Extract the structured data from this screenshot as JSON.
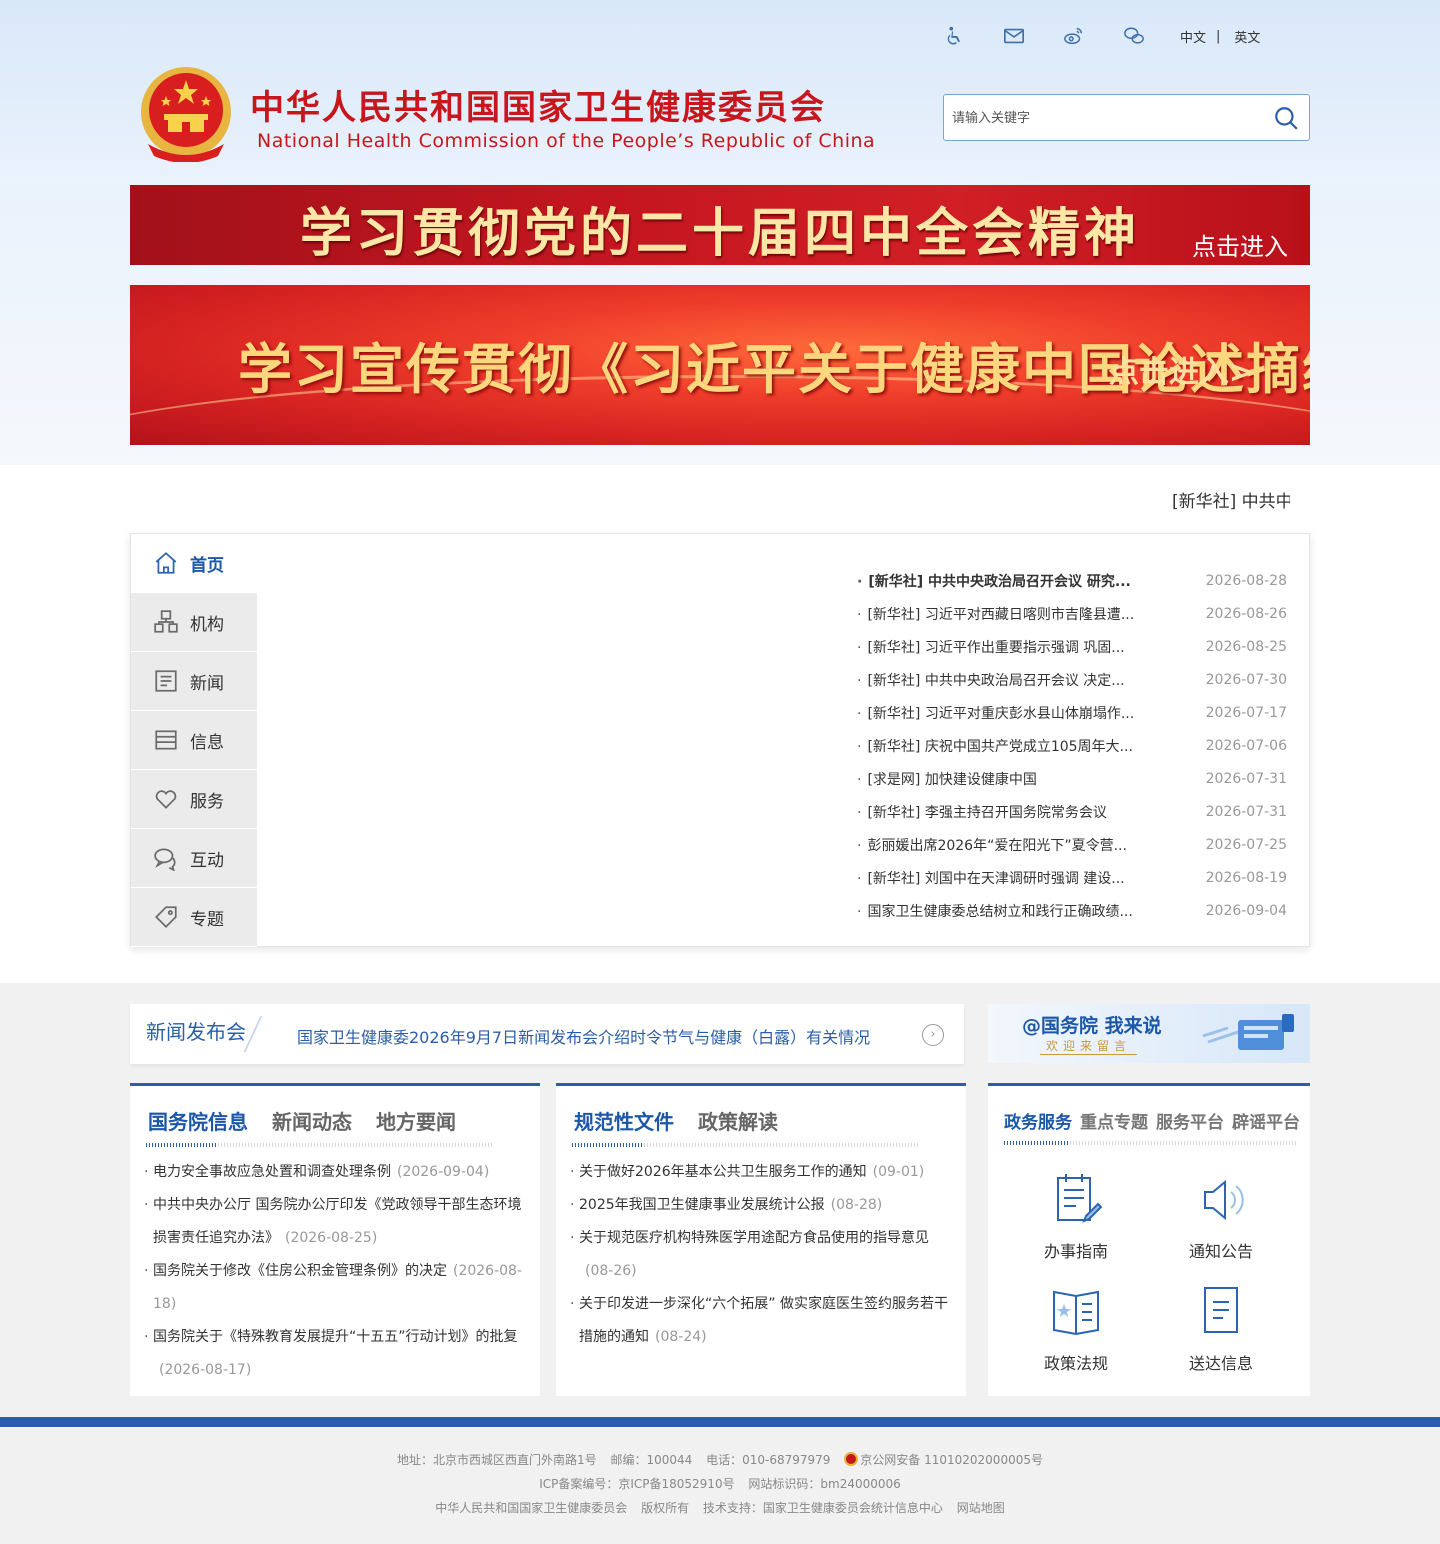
{
  "header": {
    "toolbar": {
      "icons": [
        "accessibility-icon",
        "mail-icon",
        "weibo-icon",
        "wechat-icon"
      ],
      "lang_cn": "中文",
      "lang_sep": "|",
      "lang_en": "英文"
    },
    "title_cn": "中华人民共和国国家卫生健康委员会",
    "title_en": "National Health Commission of the People’s  Republic of China",
    "search_placeholder": "请输入关键字"
  },
  "banners": {
    "b1_title": "学习贯彻党的二十届四中全会精神",
    "b1_enter": "点击进入",
    "b2_title": "学习宣传贯彻《习近平关于健康中国论述摘编》",
    "b2_enter": "点击进入>"
  },
  "ticker": "[新华社] 中共中",
  "nav": [
    {
      "label": "首页",
      "icon": "home-icon"
    },
    {
      "label": "机构",
      "icon": "org-icon"
    },
    {
      "label": "新闻",
      "icon": "news-icon"
    },
    {
      "label": "信息",
      "icon": "info-icon"
    },
    {
      "label": "服务",
      "icon": "heart-icon"
    },
    {
      "label": "互动",
      "icon": "chat-icon"
    },
    {
      "label": "专题",
      "icon": "tag-icon"
    }
  ],
  "news": [
    {
      "title": "[新华社] 中共中央政治局召开会议 研究...",
      "date": "2026-08-28"
    },
    {
      "title": "[新华社] 习近平对西藏日喀则市吉隆县遭...",
      "date": "2026-08-26"
    },
    {
      "title": "[新华社] 习近平作出重要指示强调 巩固...",
      "date": "2026-08-25"
    },
    {
      "title": "[新华社] 中共中央政治局召开会议 决定...",
      "date": "2026-07-30"
    },
    {
      "title": "[新华社] 习近平对重庆彭水县山体崩塌作...",
      "date": "2026-07-17"
    },
    {
      "title": "[新华社] 庆祝中国共产党成立105周年大...",
      "date": "2026-07-06"
    },
    {
      "title": "[求是网] 加快建设健康中国",
      "date": "2026-07-31"
    },
    {
      "title": "[新华社] 李强主持召开国务院常务会议",
      "date": "2026-07-31"
    },
    {
      "title": "彭丽媛出席2026年“爱在阳光下”夏令营...",
      "date": "2026-07-25"
    },
    {
      "title": "[新华社] 刘国中在天津调研时强调 建设...",
      "date": "2026-08-19"
    },
    {
      "title": "国家卫生健康委总结树立和践行正确政绩...",
      "date": "2026-09-04"
    }
  ],
  "press": {
    "label": "新闻发布会",
    "link": "国家卫生健康委2026年9月7日新闻发布会介绍时令节气与健康（白露）有关情况",
    "arrow": "›"
  },
  "gwy": {
    "line1": "@国务院 我来说",
    "line2": "欢迎来留言"
  },
  "card1": {
    "tabs": [
      "国务院信息",
      "新闻动态",
      "地方要闻"
    ],
    "items": [
      {
        "text": "电力安全事故应急处置和调查处理条例",
        "date": "(2026-09-04)"
      },
      {
        "text": "中共中央办公厅 国务院办公厅印发《党政领导干部生态环境损害责任追究办法》",
        "date": "(2026-08-25)"
      },
      {
        "text": "国务院关于修改《住房公积金管理条例》的决定",
        "date": "(2026-08-18)"
      },
      {
        "text": "国务院关于《特殊教育发展提升“十五五”行动计划》的批复",
        "date": "(2026-08-17)"
      }
    ]
  },
  "card2": {
    "tabs": [
      "规范性文件",
      "政策解读"
    ],
    "items": [
      {
        "text": "关于做好2026年基本公共卫生服务工作的通知",
        "date": "(09-01)"
      },
      {
        "text": "2025年我国卫生健康事业发展统计公报",
        "date": "(08-28)"
      },
      {
        "text": "关于规范医疗机构特殊医学用途配方食品使用的指导意见",
        "date": "(08-26)"
      },
      {
        "text": "关于印发进一步深化“六个拓展” 做实家庭医生签约服务若干措施的通知",
        "date": "(08-24)"
      }
    ]
  },
  "card3": {
    "tabs": [
      "政务服务",
      "重点专题",
      "服务平台",
      "辟谣平台"
    ],
    "services": [
      {
        "label": "办事指南",
        "icon": "guide-icon"
      },
      {
        "label": "通知公告",
        "icon": "speaker-icon"
      },
      {
        "label": "政策法规",
        "icon": "law-book-icon"
      },
      {
        "label": "送达信息",
        "icon": "document-icon"
      }
    ]
  },
  "footer": {
    "address": "地址：北京市西城区西直门外南路1号",
    "postcode": "邮编：100044",
    "phone": "电话：010-68797979",
    "police": "京公网安备 11010202000005号",
    "icp": "ICP备案编号：京ICP备18052910号",
    "site_id": "网站标识码：bm24000006",
    "org": "中华人民共和国国家卫生健康委员会",
    "copyright": "版权所有",
    "support": "技术支持：国家卫生健康委员会统计信息中心",
    "sitemap": "网站地图"
  },
  "colors": {
    "brand_red": "#c8161d",
    "brand_blue": "#2b5ea8"
  }
}
